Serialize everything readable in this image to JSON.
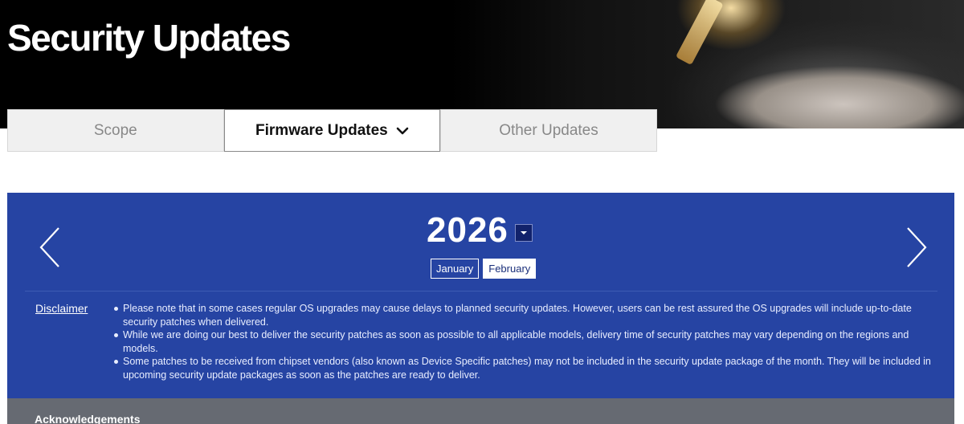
{
  "header": {
    "title": "Security Updates"
  },
  "tabs": [
    {
      "label": "Scope",
      "active": false
    },
    {
      "label": "Firmware Updates",
      "active": true
    },
    {
      "label": "Other Updates",
      "active": false
    }
  ],
  "calendar": {
    "year": "2026",
    "months": [
      "January",
      "February"
    ],
    "selected_month": "February"
  },
  "disclaimer": {
    "link_label": "Disclaimer",
    "notes": [
      "Please note that in some cases regular OS upgrades may cause delays to planned security updates. However, users can be rest assured the OS upgrades will include up-to-date security patches when delivered.",
      "While we are doing our best to deliver the security patches as soon as possible to all applicable models, delivery time of security patches may vary depending on the regions and models.",
      "Some patches to be received from chipset vendors (also known as Device Specific patches) may not be included in the security update package of the month. They will be included in upcoming security update packages as soon as the patches are ready to deliver."
    ]
  },
  "acknowledgements": {
    "label": "Acknowledgements"
  },
  "icons": {
    "prev": "chevron-left-icon",
    "next": "chevron-right-icon",
    "tab_dropdown": "chevron-down-icon",
    "year_dropdown": "caret-down-icon"
  },
  "colors": {
    "panel": "#2644a3",
    "header_bg": "#000000",
    "ack_bar": "#666a72"
  }
}
